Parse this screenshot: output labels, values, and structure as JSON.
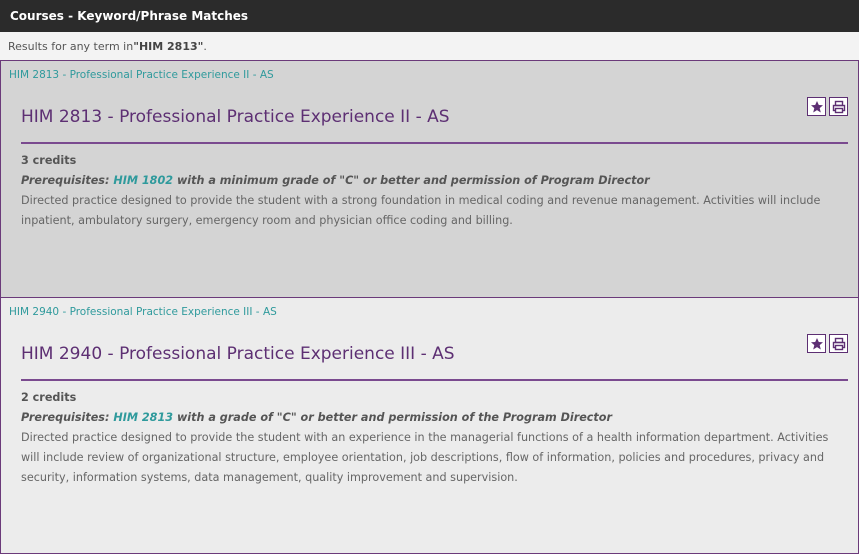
{
  "header": {
    "title": "Courses - Keyword/Phrase Matches"
  },
  "results_summary": {
    "prefix": "Results for any term in ",
    "term": "\"HIM 2813\"",
    "suffix": "."
  },
  "results": [
    {
      "link_text": "HIM 2813 - Professional Practice Experience II - AS",
      "title": "HIM 2813 - Professional Practice Experience II - AS",
      "credits": "3 credits",
      "prereq_label": "Prerequisites: ",
      "prereq_link": "HIM 1802",
      "prereq_rest": " with a minimum grade of \"C\" or better and permission of Program Director",
      "description": "Directed practice designed to provide the student with a strong foundation in medical coding and revenue management. Activities will include inpatient, ambulatory surgery, emergency room and physician office coding and billing."
    },
    {
      "link_text": "HIM 2940 - Professional Practice Experience III - AS",
      "title": "HIM 2940 - Professional Practice Experience III - AS",
      "credits": "2 credits",
      "prereq_label": "Prerequisites: ",
      "prereq_link": "HIM 2813",
      "prereq_rest": " with a grade of \"C\" or better and permission of the Program Director",
      "description": "Directed practice designed to provide the student with an experience in the managerial functions of a health information department. Activities will include review of organizational structure, employee orientation, job descriptions, flow of information, policies and procedures, privacy and security, information systems, data management, quality improvement and supervision."
    }
  ],
  "icons": {
    "favorite": "star-icon",
    "print": "printer-icon"
  },
  "colors": {
    "header_bg": "#2b2b2b",
    "title": "#5d2f73",
    "link": "#2f9a9c",
    "border": "#6b3a7a"
  }
}
